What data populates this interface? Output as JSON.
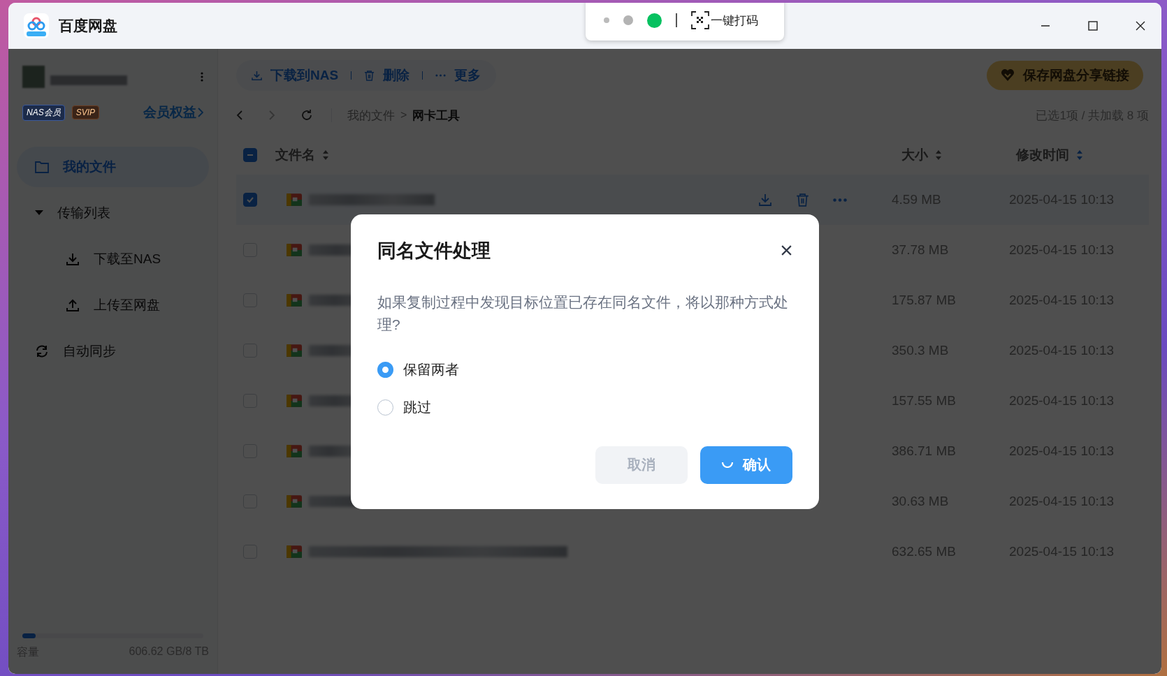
{
  "window": {
    "title": "百度网盘"
  },
  "capture_bar": {
    "label": "一键打码"
  },
  "sidebar": {
    "badges": [
      {
        "label": "NAS会员",
        "kind": "nas"
      },
      {
        "label": "SVIP",
        "kind": "svip"
      }
    ],
    "member_link": "会员权益",
    "items": [
      {
        "label": "我的文件",
        "selected": true
      },
      {
        "label": "传输列表",
        "selected": false,
        "expanded": true,
        "children": [
          {
            "label": "下载至NAS",
            "selected": false
          },
          {
            "label": "上传至网盘",
            "selected": false
          }
        ]
      },
      {
        "label": "自动同步",
        "selected": false
      }
    ],
    "storage": {
      "label": "容量",
      "reading": "606.62 GB/8 TB",
      "level": 0.074
    }
  },
  "toolbar": {
    "actions": [
      {
        "label": "下载到NAS"
      },
      {
        "label": "删除"
      },
      {
        "label": "更多"
      }
    ],
    "save_button": "保存网盘分享链接"
  },
  "breadcrumb": {
    "path": [
      "我的文件",
      "网卡工具"
    ],
    "separator": ">",
    "status": "已选1项 / 共加载 8 项"
  },
  "table": {
    "select_all_indeterminate": true,
    "columns": [
      "文件名",
      "大小",
      "修改时间"
    ],
    "rows": [
      {
        "selected": true,
        "size": "4.59 MB",
        "modified": "2025-04-15 10:13"
      },
      {
        "selected": false,
        "size": "37.78 MB",
        "modified": "2025-04-15 10:13"
      },
      {
        "selected": false,
        "size": "175.87 MB",
        "modified": "2025-04-15 10:13"
      },
      {
        "selected": false,
        "size": "350.3 MB",
        "modified": "2025-04-15 10:13"
      },
      {
        "selected": false,
        "size": "157.55 MB",
        "modified": "2025-04-15 10:13"
      },
      {
        "selected": false,
        "size": "386.71 MB",
        "modified": "2025-04-15 10:13"
      },
      {
        "selected": false,
        "size": "30.63 MB",
        "modified": "2025-04-15 10:13"
      },
      {
        "selected": false,
        "size": "632.65 MB",
        "modified": "2025-04-15 10:13"
      }
    ]
  },
  "dialog": {
    "title": "同名文件处理",
    "message": "如果复制过程中发现目标位置已存在同名文件，将以那种方式处理?",
    "options": [
      {
        "label": "保留两者",
        "selected": true
      },
      {
        "label": "跳过",
        "selected": false
      }
    ],
    "cancel": "取消",
    "confirm": "确认",
    "confirm_loading": true
  }
}
